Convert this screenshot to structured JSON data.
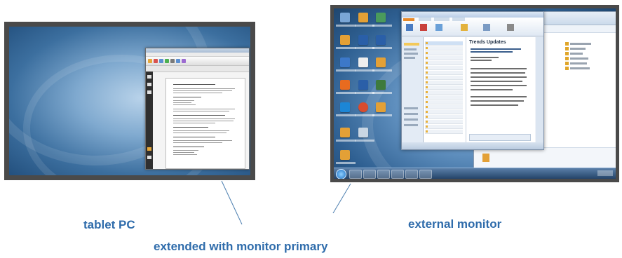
{
  "labels": {
    "tablet": "tablet PC",
    "monitor": "external monitor",
    "configuration": "extended with monitor primary"
  },
  "colors": {
    "label_text": "#2f6cab",
    "screen_bezel": "#4a4a4a",
    "pointer_line": "#4d7fb0"
  },
  "monitor_window": {
    "heading": "Trends Updates"
  },
  "icons": [
    "desktop-background-swirl",
    "document-window",
    "outlook-window",
    "explorer-window",
    "taskbar",
    "start-orb-icon"
  ]
}
